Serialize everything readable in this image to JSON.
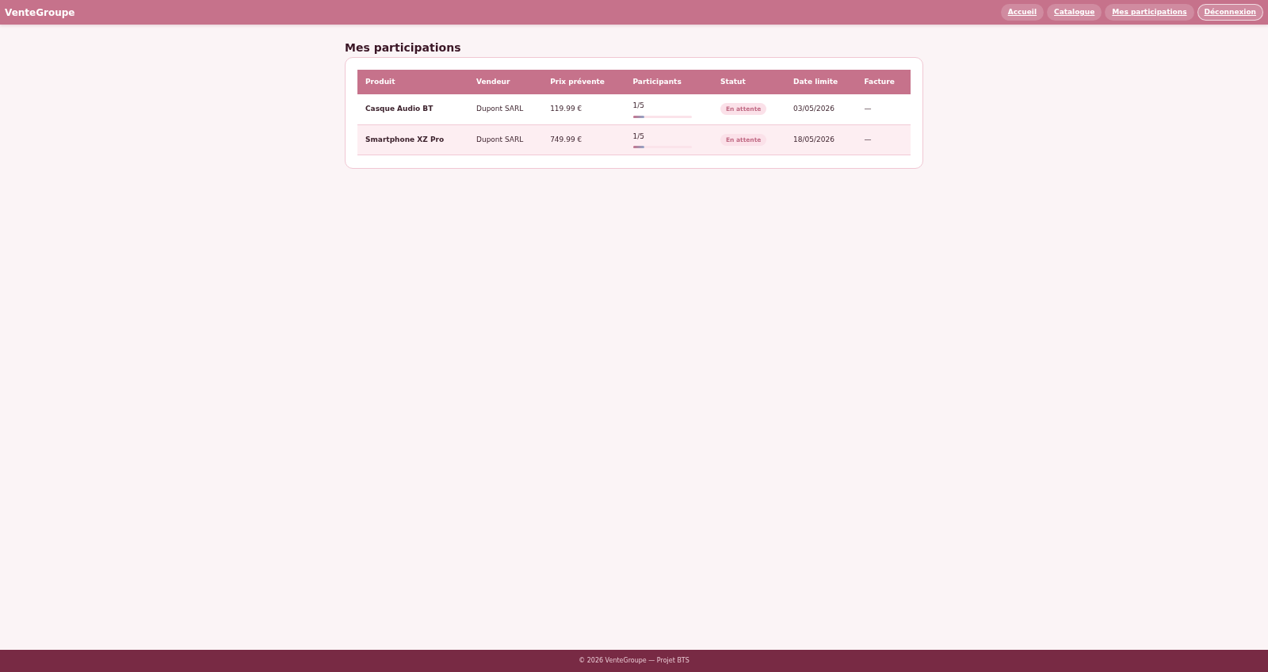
{
  "navbar": {
    "brand": "VenteGroupe",
    "links": [
      {
        "label": "Accueil",
        "kind": "pill"
      },
      {
        "label": "Catalogue",
        "kind": "pill"
      },
      {
        "label": "Mes participations",
        "kind": "pill"
      },
      {
        "label": "Déconnexion",
        "kind": "outline"
      }
    ]
  },
  "page": {
    "title": "Mes participations"
  },
  "table": {
    "columns": [
      "Produit",
      "Vendeur",
      "Prix prévente",
      "Participants",
      "Statut",
      "Date limite",
      "Facture"
    ],
    "rows": [
      {
        "product": "Casque Audio BT",
        "seller": "Dupont SARL",
        "price": "119.99 €",
        "participants": "1/5",
        "level": 0.2,
        "status": "En attente",
        "deadline": "03/05/2026",
        "invoice": "—"
      },
      {
        "product": "Smartphone XZ Pro",
        "seller": "Dupont SARL",
        "price": "749.99 €",
        "participants": "1/5",
        "level": 0.2,
        "status": "En attente",
        "deadline": "18/05/2026",
        "invoice": "—"
      }
    ]
  },
  "footer": {
    "text": "© 2026 VenteGroupe — Projet BTS"
  }
}
